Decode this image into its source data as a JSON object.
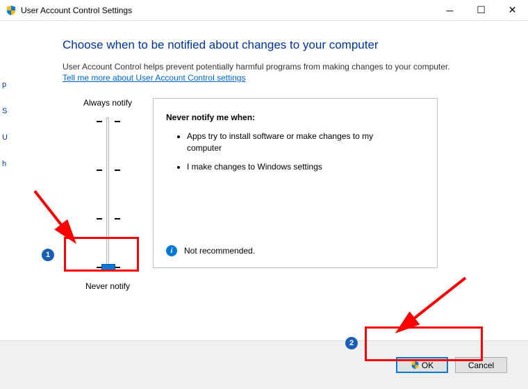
{
  "window": {
    "title": "User Account Control Settings"
  },
  "heading": "Choose when to be notified about changes to your computer",
  "subtext": "User Account Control helps prevent potentially harmful programs from making changes to your computer.",
  "link_text": "Tell me more about User Account Control settings",
  "slider": {
    "top_label": "Always notify",
    "bottom_label": "Never notify",
    "levels": 4,
    "current_level": 0
  },
  "description": {
    "title": "Never notify me when:",
    "bullets": [
      "Apps try to install software or make changes to my computer",
      "I make changes to Windows settings"
    ],
    "recommendation": "Not recommended."
  },
  "buttons": {
    "ok": "OK",
    "cancel": "Cancel"
  },
  "callouts": {
    "one": "1",
    "two": "2"
  },
  "leftfrag": [
    "p",
    "S",
    "U",
    "h"
  ]
}
